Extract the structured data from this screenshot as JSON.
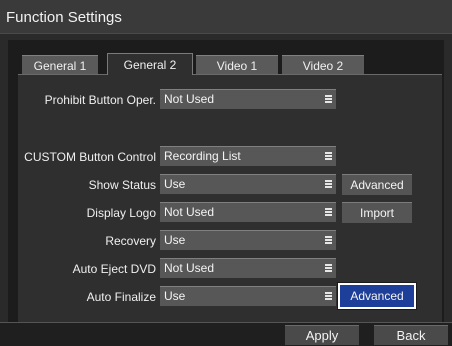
{
  "window": {
    "title": "Function Settings"
  },
  "tabs": [
    {
      "label": "General 1",
      "active": false
    },
    {
      "label": "General 2",
      "active": true
    },
    {
      "label": "Video 1",
      "active": false
    },
    {
      "label": "Video 2",
      "active": false
    }
  ],
  "settings": [
    {
      "label": "Prohibit Button Oper.",
      "value": "Not Used"
    },
    {
      "label": "CUSTOM Button Control",
      "value": "Recording List"
    },
    {
      "label": "Show Status",
      "value": "Use",
      "button": "Advanced"
    },
    {
      "label": "Display Logo",
      "value": "Not Used",
      "button": "Import"
    },
    {
      "label": "Recovery",
      "value": "Use"
    },
    {
      "label": "Auto Eject DVD",
      "value": "Not Used"
    },
    {
      "label": "Auto Finalize",
      "value": "Use",
      "button": "Advanced",
      "button_selected": true
    }
  ],
  "footer": {
    "apply_label": "Apply",
    "back_label": "Back"
  },
  "colors": {
    "selected_button": "#1e3f99",
    "panel": "#2f2f2f",
    "field": "#575757"
  },
  "icons": {
    "select_arrow": "list-arrow-icon"
  }
}
